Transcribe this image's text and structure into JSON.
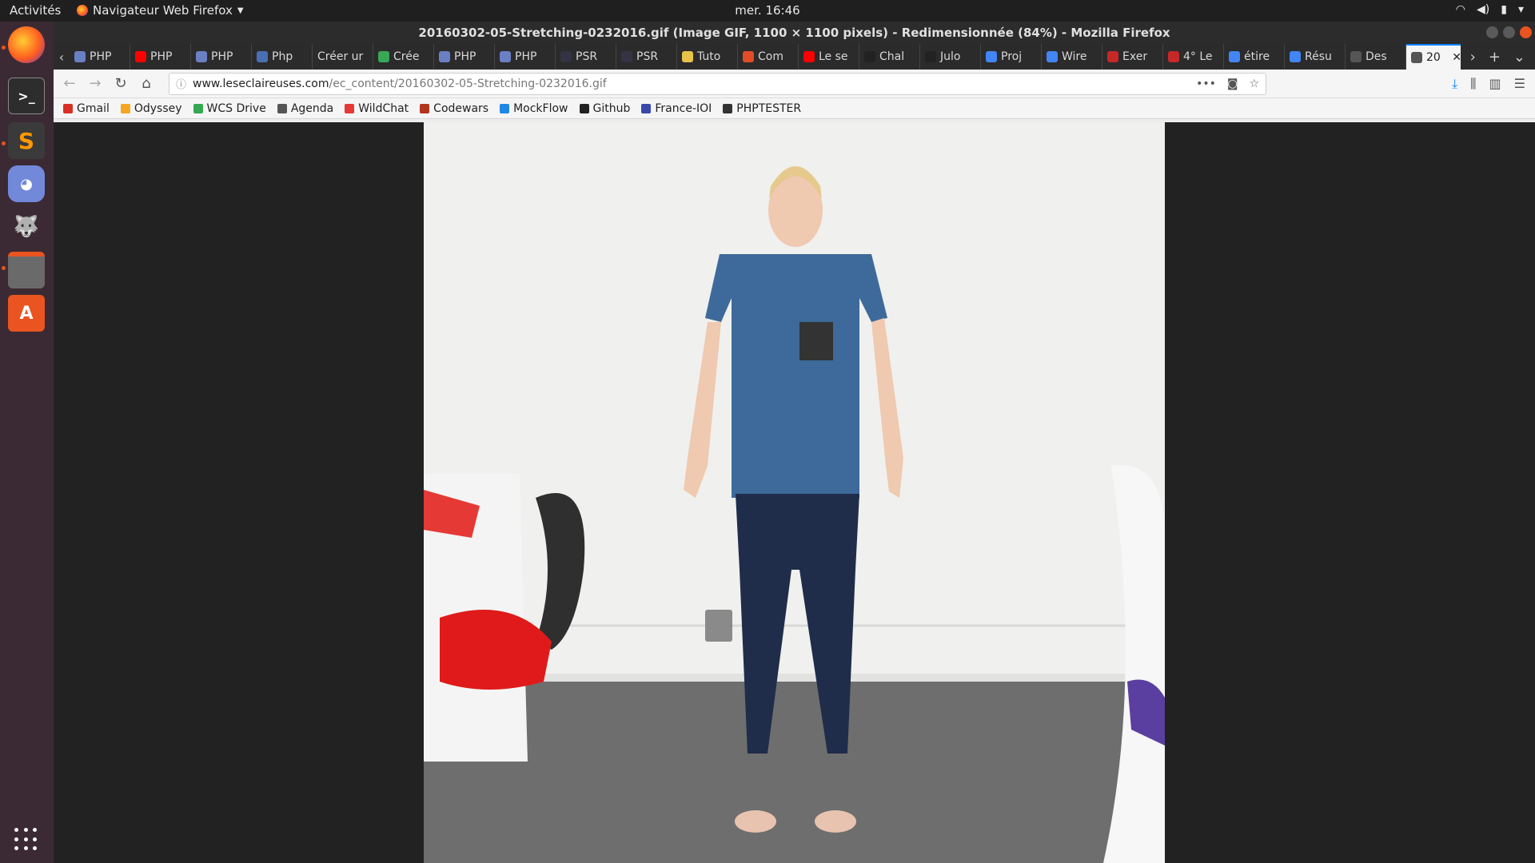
{
  "topbar": {
    "activities": "Activités",
    "app_name": "Navigateur Web Firefox",
    "clock": "mer. 16:46"
  },
  "window": {
    "title": "20160302-05-Stretching-0232016.gif (Image GIF, 1100 × 1100 pixels) - Redimensionnée (84%) - Mozilla Firefox"
  },
  "tabs": [
    {
      "label": "PHP",
      "color": "#6b7fc4"
    },
    {
      "label": "PHP",
      "color": "#ff0000"
    },
    {
      "label": "PHP",
      "color": "#6b7fc4"
    },
    {
      "label": "Php",
      "color": "#4a6fb5"
    },
    {
      "label": "Créer ur",
      "color": ""
    },
    {
      "label": "Crée",
      "color": "#3aa757"
    },
    {
      "label": "PHP",
      "color": "#6b7fc4"
    },
    {
      "label": "PHP",
      "color": "#6b7fc4"
    },
    {
      "label": "PSR",
      "color": "#334"
    },
    {
      "label": "PSR",
      "color": "#334"
    },
    {
      "label": "Tuto",
      "color": "#e8c34a"
    },
    {
      "label": "Com",
      "color": "#e34c26"
    },
    {
      "label": "Le se",
      "color": "#ff0000"
    },
    {
      "label": "Chal",
      "color": "#222"
    },
    {
      "label": "Julo",
      "color": "#222"
    },
    {
      "label": "Proj",
      "color": "#4285f4"
    },
    {
      "label": "Wire",
      "color": "#4285f4"
    },
    {
      "label": "Exer",
      "color": "#c62828"
    },
    {
      "label": "4° Le",
      "color": "#c62828"
    },
    {
      "label": "étire",
      "color": "#4285f4"
    },
    {
      "label": "Résu",
      "color": "#4285f4"
    },
    {
      "label": "Des",
      "color": "#555"
    },
    {
      "label": "20",
      "color": "#555",
      "active": true
    }
  ],
  "navbar": {
    "url_host": "www.leseclaireuses.com",
    "url_path": "/ec_content/20160302-05-Stretching-0232016.gif"
  },
  "bookmarks": [
    {
      "label": "Gmail",
      "color": "#d93025"
    },
    {
      "label": "Odyssey",
      "color": "#f5a623"
    },
    {
      "label": "WCS Drive",
      "color": "#34a853"
    },
    {
      "label": "Agenda",
      "color": "#555"
    },
    {
      "label": "WildChat",
      "color": "#e53935"
    },
    {
      "label": "Codewars",
      "color": "#b1361e"
    },
    {
      "label": "MockFlow",
      "color": "#1e88e5"
    },
    {
      "label": "Github",
      "color": "#222"
    },
    {
      "label": "France-IOI",
      "color": "#3949ab"
    },
    {
      "label": "PHPTESTER",
      "color": "#333"
    }
  ],
  "dock": [
    {
      "name": "firefox",
      "color": "#e95420"
    },
    {
      "name": "terminal",
      "color": "#2d2d2d"
    },
    {
      "name": "sublime-text",
      "color": "#4a4a4a"
    },
    {
      "name": "discord",
      "color": "#7289da"
    },
    {
      "name": "gimp",
      "color": "#5c5c5c"
    },
    {
      "name": "files",
      "color": "#6a6a6a"
    },
    {
      "name": "software-center",
      "color": "#e95420"
    }
  ]
}
